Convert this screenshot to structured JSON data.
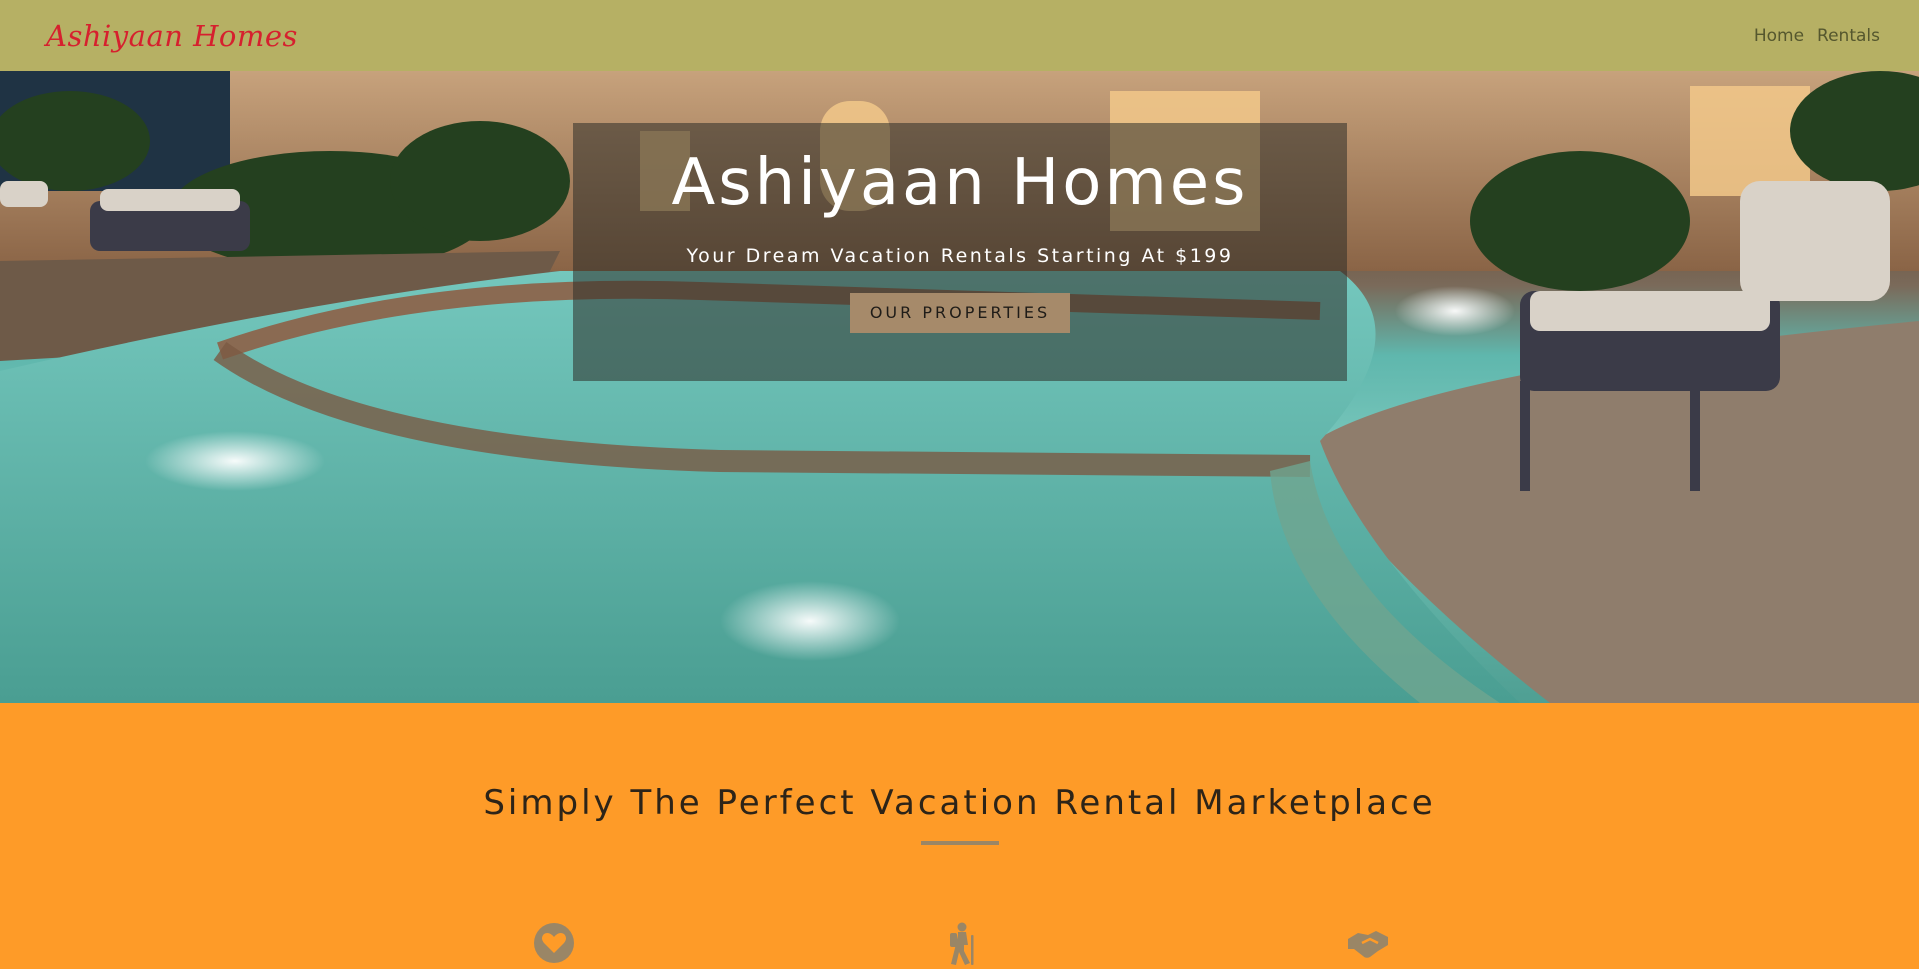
{
  "navbar": {
    "brand": "Ashiyaan Homes",
    "links": [
      {
        "label": "Home"
      },
      {
        "label": "Rentals"
      }
    ]
  },
  "hero": {
    "title": "Ashiyaan Homes",
    "subtitle": "Your Dream Vacation Rentals Starting At $199",
    "button_label": "OUR PROPERTIES"
  },
  "features": {
    "heading": "Simply The Perfect Vacation Rental Marketplace",
    "icons": [
      "heart-icon",
      "hiker-icon",
      "handshake-icon"
    ]
  },
  "colors": {
    "navbar_bg": "#b6b064",
    "brand": "#d6202e",
    "features_bg": "#fe9b28",
    "button_bg": "#a68a6a",
    "icon": "#9a8666"
  }
}
